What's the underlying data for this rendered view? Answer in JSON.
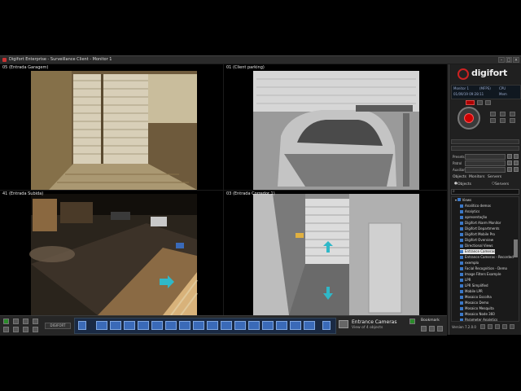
{
  "window": {
    "title": "Digifort Enterprise - Surveillance Client - Monitor 1"
  },
  "cameras": [
    {
      "label": "05 (Entrada Garagem)"
    },
    {
      "label": "01 (Client parking)"
    },
    {
      "label": "41 (Entrada Subida)"
    },
    {
      "label": "03 (Entrada Corredor 1)"
    }
  ],
  "bottombar": {
    "view_name": "Entrance Cameras",
    "view_sub": "View of 4 objects",
    "bookmark_label": "Bookmark",
    "logo_text": "DIGIFORT"
  },
  "side": {
    "brand": "digifort",
    "info": {
      "monitor": "Monitor 1",
      "fps": "(MFPS)",
      "cpu": "CPU",
      "datetime": "01/09/19 09:28:11",
      "mem": "Mem"
    },
    "rows": [
      {
        "label": "Presets"
      },
      {
        "label": "Patrol"
      },
      {
        "label": "Auxiliary"
      }
    ],
    "tabs": [
      "Objects",
      "Monitors",
      "Servers"
    ],
    "radios": [
      "Objects",
      "Servers"
    ],
    "tree_root": "Views",
    "tree_items": [
      "Analitico demos",
      "Analytics",
      "apresentação",
      "Digifort Alarm Monitor",
      "Digifort Departments",
      "Digifort Mobile Pro",
      "Digifort Overview",
      "Directional Views",
      "Entrance Cameras",
      "Entrance Cameras - Recorded",
      "exemplo",
      "Facial Recognition - Demo",
      "Image Filters Example",
      "LPR",
      "LPR Simplified",
      "Mobile LPR",
      "Mosaico Escolha",
      "Mosaico Demo",
      "Mosaico Mesquita",
      "Mosaico Node 360",
      "Parameter Analytics"
    ],
    "selected_item": "Entrance Cameras",
    "version": "Version 7.2.0.0"
  },
  "colors": {
    "accent": "#3a6ab8",
    "brand_red": "#c22222",
    "arrow": "#2fb8c8"
  }
}
